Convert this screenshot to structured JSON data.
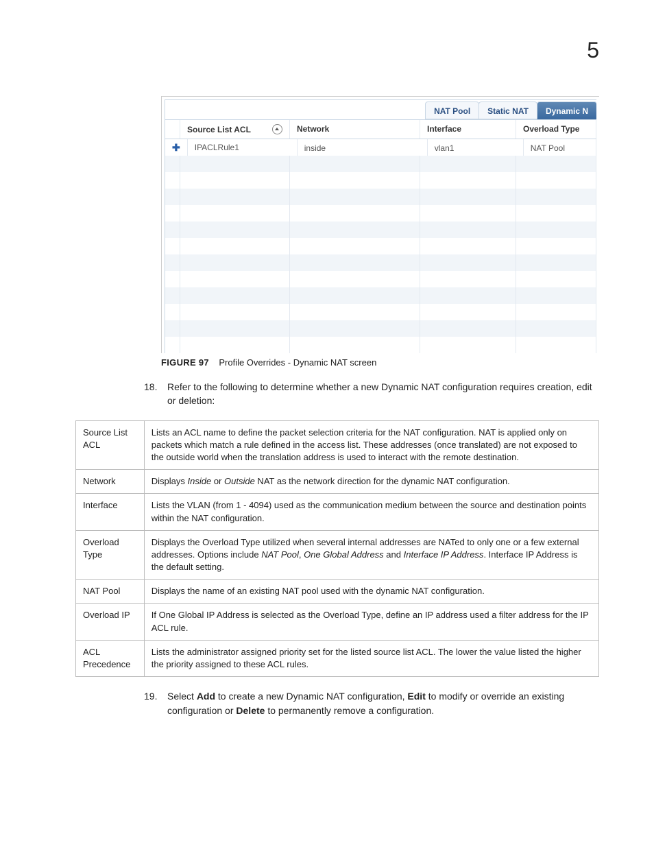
{
  "page_number": "5",
  "screenshot": {
    "tabs": {
      "nat_pool": "NAT Pool",
      "static_nat": "Static NAT",
      "dynamic_nat": "Dynamic N"
    },
    "headers": {
      "source_list_acl": "Source List ACL",
      "network": "Network",
      "interface": "Interface",
      "overload_type": "Overload Type"
    },
    "row1": {
      "acl": "IPACLRule1",
      "network": "inside",
      "interface": "vlan1",
      "overload_type": "NAT Pool"
    }
  },
  "caption": {
    "label": "FIGURE 97",
    "text": "Profile Overrides - Dynamic NAT screen"
  },
  "step18": {
    "num": "18.",
    "text": "Refer to the following to determine whether a new Dynamic NAT configuration requires creation, edit or deletion:"
  },
  "desc": {
    "source_list_acl": {
      "term": "Source List ACL",
      "text": "Lists an ACL name to define the packet selection criteria for the NAT configuration. NAT is applied only on packets which match a rule defined in the access list. These addresses (once translated) are not exposed to the outside world when the translation address is used to interact with the remote destination."
    },
    "network": {
      "term": "Network",
      "pre": "Displays ",
      "i1": "Inside",
      "mid1": " or ",
      "i2": "Outside",
      "post": " NAT as the network direction for the dynamic NAT configuration."
    },
    "interface_row": {
      "term": "Interface",
      "text": "Lists the VLAN (from 1 - 4094) used as the communication medium between the source and destination points within the NAT configuration."
    },
    "overload_type": {
      "term": "Overload Type",
      "pre": "Displays the Overload Type utilized when several internal addresses are NATed to only one or a few external addresses. Options include ",
      "i1": "NAT Pool",
      "mid1": ", ",
      "i2": "One Global Address",
      "mid2": " and ",
      "i3": "Interface IP Address",
      "post": ". Interface IP Address is the default setting."
    },
    "nat_pool": {
      "term": "NAT Pool",
      "text": "Displays the name of an existing NAT pool used with the dynamic NAT configuration."
    },
    "overload_ip": {
      "term": "Overload IP",
      "text": "If One Global IP Address is selected as the Overload Type, define an IP address used a filter address for the IP ACL rule."
    },
    "acl_precedence": {
      "term": "ACL Precedence",
      "text": "Lists the administrator assigned priority set for the listed source list ACL. The lower the value listed the higher the priority assigned to these ACL rules."
    }
  },
  "step19": {
    "num": "19.",
    "pre": "Select ",
    "b1": "Add",
    "mid1": " to create a new Dynamic NAT configuration, ",
    "b2": "Edit",
    "mid2": " to modify or override an existing configuration or ",
    "b3": "Delete",
    "post": " to permanently remove a configuration."
  }
}
